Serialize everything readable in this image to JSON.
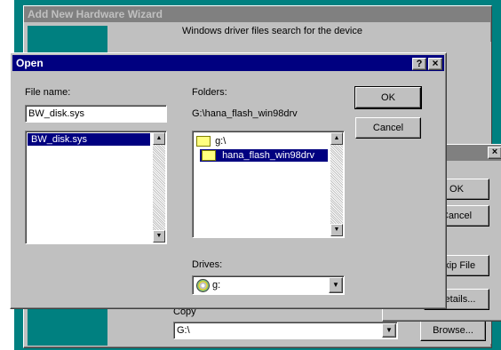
{
  "background_window": {
    "title": "Add New Hardware Wizard",
    "partial_text": "Windows driver files search for the device",
    "path_label_partial": "Copy",
    "path_value": "G:\\",
    "browse_label": "Browse..."
  },
  "side_window": {
    "ok_label": "OK",
    "cancel_label": "Cancel",
    "skip_file_label": "Skip File",
    "details_label": "Details...",
    "close_glyph": "×"
  },
  "open_dialog": {
    "title": "Open",
    "help_glyph": "?",
    "close_glyph": "×",
    "file_name_label": "File name:",
    "file_name_value": "BW_disk.sys",
    "files": [
      "BW_disk.sys"
    ],
    "folders_label": "Folders:",
    "current_path": "G:\\hana_flash_win98drv",
    "folder_items": [
      {
        "name": "g:\\",
        "icon": "open-folder-icon"
      },
      {
        "name": "hana_flash_win98drv",
        "icon": "open-folder-icon",
        "selected": true
      }
    ],
    "drives_label": "Drives:",
    "drive_value": "g:",
    "ok_label": "OK",
    "cancel_label": "Cancel"
  },
  "colors": {
    "title_active": "#000080",
    "title_inactive": "#808080",
    "desktop": "#008080",
    "selection": "#000080"
  }
}
